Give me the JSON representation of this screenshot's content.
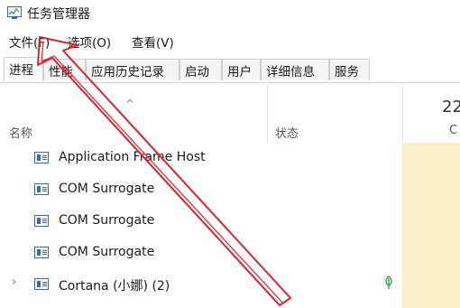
{
  "window": {
    "title": "任务管理器"
  },
  "menu": {
    "file": "文件(F)",
    "options": "选项(O)",
    "view": "查看(V)"
  },
  "tabs": [
    "进程",
    "性能",
    "应用历史记录",
    "启动",
    "用户",
    "详细信息",
    "服务"
  ],
  "columns": {
    "name": "名称",
    "status": "状态",
    "cpu_percent": "22",
    "cpu": "C"
  },
  "rows": [
    {
      "name": "Application Frame Host"
    },
    {
      "name": "COM Surrogate"
    },
    {
      "name": "COM Surrogate"
    },
    {
      "name": "COM Surrogate"
    },
    {
      "name": "Cortana (小娜) (2)"
    }
  ],
  "colors": {
    "cpu_highlight": "#fbf1c9",
    "annotation_arrow": "#d0262e",
    "icon_blue": "#3c6aa0"
  },
  "icons": {
    "app": "task-manager-icon",
    "process": "process-window-icon",
    "expand": "chevron-right-icon",
    "suspended": "leaf-icon"
  }
}
